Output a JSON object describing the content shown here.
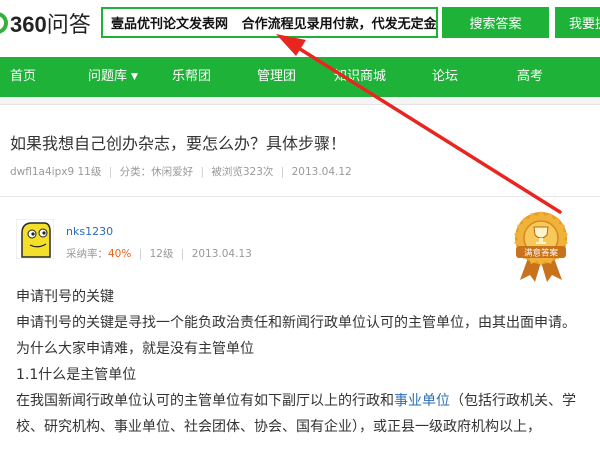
{
  "header": {
    "logo_num": "360",
    "logo_text": "问答",
    "search_value": "壹品优刊论文发表网   合作流程见录用付款，代发无定金！",
    "search_button": "搜索答案",
    "ask_button": "我要提问"
  },
  "nav": {
    "items": [
      {
        "label": "首页"
      },
      {
        "label": "问题库"
      },
      {
        "label": "乐帮团"
      },
      {
        "label": "管理团"
      },
      {
        "label": "知识商城"
      },
      {
        "label": "论坛"
      },
      {
        "label": "高考"
      }
    ]
  },
  "question": {
    "title": "如果我想自己创办杂志，要怎么办？具体步骤！",
    "author": "dwfl1a4ipx9",
    "level": "11级",
    "category": "分类：休闲爱好",
    "views": "被浏览323次",
    "date": "2013.04.12"
  },
  "answer": {
    "user": "nks1230",
    "rate_label": "采纳率：",
    "rate_value": "40%",
    "level": "12级",
    "date": "2013.04.13",
    "badge_text": "满意答案",
    "para1": "申请刊号的关键",
    "para2": "申请刊号的关键是寻找一个能负政治责任和新闻行政单位认可的主管单位，由其出面申请。为什么大家申请难，就是没有主管单位",
    "para3": "1.1什么是主管单位",
    "para4_before": "在我国新闻行政单位认可的主管单位有如下副厅以上的行政和",
    "para4_link": "事业单位",
    "para4_after": "（包括行政机关、学 校、研究机构、事业单位、社会团体、协会、国有企业），或正县一级政府机构以上，"
  },
  "colors": {
    "brand_green": "#1eb239",
    "link_blue": "#2b6eb5",
    "rate_orange": "#e8641b",
    "arrow_red": "#e8251f"
  }
}
